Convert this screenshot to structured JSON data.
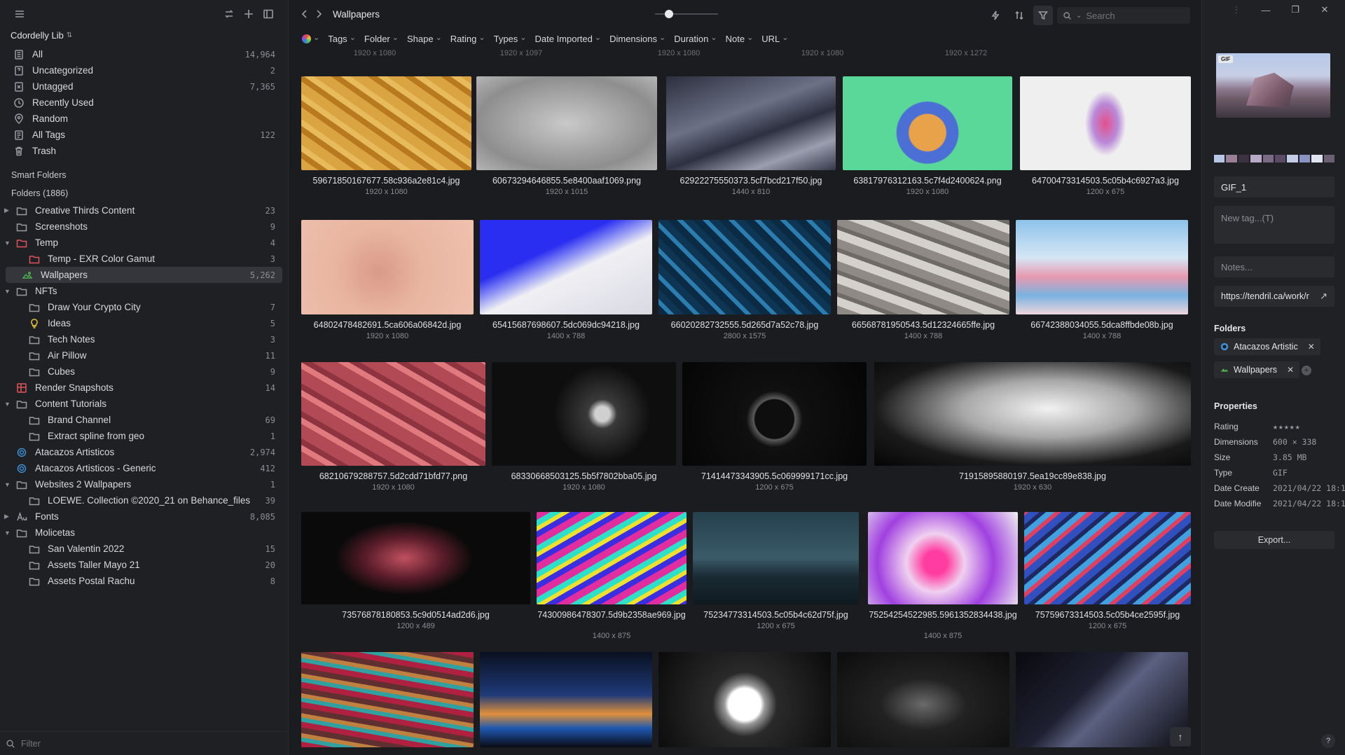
{
  "sidebar": {
    "library": "Cdordelly Lib",
    "items": [
      {
        "label": "All",
        "count": "14,964",
        "icon": "all-icon"
      },
      {
        "label": "Uncategorized",
        "count": "2",
        "icon": "uncategorized-icon"
      },
      {
        "label": "Untagged",
        "count": "7,365",
        "icon": "untagged-icon"
      },
      {
        "label": "Recently Used",
        "count": "",
        "icon": "clock-icon"
      },
      {
        "label": "Random",
        "count": "",
        "icon": "random-icon"
      },
      {
        "label": "All Tags",
        "count": "122",
        "icon": "tags-icon"
      },
      {
        "label": "Trash",
        "count": "",
        "icon": "trash-icon"
      }
    ],
    "smart_folders": "Smart Folders",
    "folders_header": "Folders (1886)",
    "folders": [
      {
        "label": "Creative Thirds Content",
        "count": "23",
        "level": 1,
        "caret": "right",
        "icon": "folder-icon"
      },
      {
        "label": "Screenshots",
        "count": "9",
        "level": 1,
        "caret": "",
        "icon": "folder-icon"
      },
      {
        "label": "Temp",
        "count": "4",
        "level": 1,
        "caret": "down",
        "icon": "folder-red-icon"
      },
      {
        "label": "Temp - EXR Color Gamut",
        "count": "3",
        "level": 2,
        "caret": "",
        "icon": "folder-red-icon"
      },
      {
        "label": "Wallpapers",
        "count": "5,262",
        "level": 1,
        "caret": "",
        "icon": "smart-folder-green-icon",
        "active": true
      },
      {
        "label": "NFTs",
        "count": "",
        "level": 1,
        "caret": "down",
        "icon": "folder-icon"
      },
      {
        "label": "Draw Your Crypto City",
        "count": "7",
        "level": 2,
        "caret": "",
        "icon": "folder-icon"
      },
      {
        "label": "Ideas",
        "count": "5",
        "level": 2,
        "caret": "",
        "icon": "lightbulb-icon"
      },
      {
        "label": "Tech Notes",
        "count": "3",
        "level": 2,
        "caret": "",
        "icon": "folder-icon"
      },
      {
        "label": "Air Pillow",
        "count": "11",
        "level": 2,
        "caret": "",
        "icon": "folder-icon"
      },
      {
        "label": "Cubes",
        "count": "9",
        "level": 2,
        "caret": "",
        "icon": "folder-icon"
      },
      {
        "label": "Render Snapshots",
        "count": "14",
        "level": 1,
        "caret": "",
        "icon": "render-icon"
      },
      {
        "label": "Content Tutorials",
        "count": "",
        "level": 1,
        "caret": "down",
        "icon": "folder-icon"
      },
      {
        "label": "Brand Channel",
        "count": "69",
        "level": 2,
        "caret": "",
        "icon": "folder-icon"
      },
      {
        "label": "Extract spline from geo",
        "count": "1",
        "level": 2,
        "caret": "",
        "icon": "folder-icon"
      },
      {
        "label": "Atacazos Artisticos",
        "count": "2,974",
        "level": 1,
        "caret": "",
        "icon": "smart-folder-blue-icon"
      },
      {
        "label": "Atacazos Artisticos - Generic",
        "count": "412",
        "level": 1,
        "caret": "",
        "icon": "smart-folder-blue-icon"
      },
      {
        "label": "Websites 2 Wallpapers",
        "count": "1",
        "level": 1,
        "caret": "down",
        "icon": "folder-icon"
      },
      {
        "label": "LOEWE. Collection ©2020_21 on Behance_files",
        "count": "39",
        "level": 2,
        "caret": "",
        "icon": "folder-icon"
      },
      {
        "label": "Fonts",
        "count": "8,085",
        "level": 1,
        "caret": "right",
        "icon": "font-icon"
      },
      {
        "label": "Molicetas",
        "count": "",
        "level": 1,
        "caret": "down",
        "icon": "folder-icon"
      },
      {
        "label": "San Valentin 2022",
        "count": "15",
        "level": 2,
        "caret": "",
        "icon": "folder-icon"
      },
      {
        "label": "Assets Taller Mayo 21",
        "count": "20",
        "level": 2,
        "caret": "",
        "icon": "folder-icon"
      },
      {
        "label": "Assets Postal Rachu",
        "count": "8",
        "level": 2,
        "caret": "",
        "icon": "folder-icon"
      }
    ],
    "filter_placeholder": "Filter"
  },
  "toolbar": {
    "breadcrumb": "Wallpapers",
    "search_placeholder": "Search",
    "filters": [
      "Tags",
      "Folder",
      "Shape",
      "Rating",
      "Types",
      "Date Imported",
      "Dimensions",
      "Duration",
      "Note",
      "URL"
    ]
  },
  "grid": {
    "top_dims": [
      "1920 x 1080",
      "1920 x 1097",
      "1920 x 1080",
      "1920 x 1080",
      "1920 x 1272"
    ],
    "items": [
      {
        "name": "59671850167677.58c936a2e81c4.jpg",
        "dims": "1920 x 1080",
        "bg": "repeating-linear-gradient(35deg,#d9a441 0 14px,#b8791f 14px 22px,#e7bb5c 22px 30px)"
      },
      {
        "name": "60673294646855.5e8400aaf1069.png",
        "dims": "1920 x 1015",
        "bg": "radial-gradient(ellipse at 50% 50%,#c9c9c9,#8e8e8e 70%,#b5b5b5)"
      },
      {
        "name": "62922275550373.5cf7bcd217f50.jpg",
        "dims": "1440 x 810",
        "bg": "linear-gradient(160deg,#2b2f3e,#6c7186 40%,#2c3040 60%,#9a9fb0 80%,#333748)"
      },
      {
        "name": "63817976312163.5c7f4d2400624.png",
        "dims": "1920 x 1080",
        "bg": "radial-gradient(circle at 50% 60%,#e8a24a 0 18%,#4b6fd4 19% 30%,#5ad89a 31%)"
      },
      {
        "name": "64700473314503.5c05b4c6927a3.jpg",
        "dims": "1200 x 675",
        "bg": "radial-gradient(ellipse 12% 35% at 50% 50%,#e4508c,#b989d8 60%,#efefef 100%)"
      },
      {
        "name": "64802478482691.5ca606a06842d.jpg",
        "dims": "1920 x 1080",
        "bg": "radial-gradient(circle at 45% 55%,#d99a88,#e8b5a0 40%,#f0c1ae)"
      },
      {
        "name": "65415687698607.5dc069dc94218.jpg",
        "dims": "1400 x 788",
        "bg": "linear-gradient(155deg,#2a2ef0 0 35%,#8a8ff5 45%,#f0f0f4 55%,#d8d9e2)"
      },
      {
        "name": "66020282732555.5d265d7a52c78.jpg",
        "dims": "2800 x 1575",
        "bg": "repeating-linear-gradient(45deg,#0b2a44 0 10px,#2b7db0 10px 16px,#0e3554 16px 26px)"
      },
      {
        "name": "66568781950543.5d12324665ffe.jpg",
        "dims": "1400 x 788",
        "bg": "repeating-linear-gradient(20deg,#8f8a85 0 12px,#d4d0cb 12px 24px,#6e6a66 24px 30px)"
      },
      {
        "name": "66742388034055.5dca8ffbde08b.jpg",
        "dims": "1400 x 788",
        "bg": "linear-gradient(180deg,#8ec3ea 0%,#d5e6f5 40%,#e89ab0 60%,#7ab2e0 80%,#f0d6de)"
      },
      {
        "name": "68210679288757.5d2cdd71bfd77.png",
        "dims": "1920 x 1080",
        "bg": "repeating-linear-gradient(30deg,#b14a55 0 18px,#e07a7e 18px 26px,#8e3440 26px 34px)"
      },
      {
        "name": "68330668503125.5b5f7802bba05.jpg",
        "dims": "1920 x 1080",
        "bg": "radial-gradient(circle at 60% 50%,#d0d0d0 0 6%,#3a3a3a 12%,#0e0e0e 40%)"
      },
      {
        "name": "71414473343905.5c069999171cc.jpg",
        "dims": "1200 x 675",
        "bg": "radial-gradient(circle at 50% 55%,#0e0e0e 0 18%,#5a5a5a 19%,#101010 26%,#050505)"
      },
      {
        "name": "71915895880197.5ea19cc89e838.jpg",
        "dims": "1920 x 630",
        "bg": "radial-gradient(ellipse at 55% 45%,#f2f2f2,#a8a8a8 35%,#1a1a1a 70%,#050505)"
      },
      {
        "name": "73576878180853.5c9d0514ad2d6.jpg",
        "dims": "1200 x 489",
        "bg": "radial-gradient(ellipse 30% 40% at 45% 50%,#c05060,#5c1d2a 55%,#0a0a0a)"
      },
      {
        "name": "74300986478307.5d9b2358ae969.jpg",
        "dims": "1400 x 875",
        "bg": "repeating-linear-gradient(150deg,#e02ea0 0 10px,#2ee0c8 10px 18px,#f0e02e 18px 24px,#3a2ee0 24px 32px)"
      },
      {
        "name": "75234773314503.5c05b4c62d75f.jpg",
        "dims": "1200 x 675",
        "bg": "linear-gradient(180deg,#26404e,#3a5a68 50%,#1a2a33 70%,#0f1a20)"
      },
      {
        "name": "75254254522985.5961352834438.jpg",
        "dims": "1400 x 875",
        "bg": "radial-gradient(circle at 45% 55%,#ff3da0 0 12%,#f0d0f0 30%,#a040e0 60%,#f0f0f0)"
      },
      {
        "name": "75759673314503.5c05b4ce2595f.jpg",
        "dims": "1200 x 675",
        "bg": "repeating-linear-gradient(-40deg,#3050c0 0 10px,#e04060 10px 16px,#40a0e0 16px 24px,#202860 24px 30px)"
      },
      {
        "name": "",
        "dims": "",
        "bg": "repeating-linear-gradient(10deg,#b02040 0 8px,#30a0a0 8px 14px,#c08040 14px 20px,#603030 20px 28px)"
      },
      {
        "name": "",
        "dims": "",
        "bg": "linear-gradient(180deg,#0a1020 0%,#1e3a78 45%,#e0903a 65%,#1e58b0 80%,#0a0a14)"
      },
      {
        "name": "",
        "dims": "",
        "bg": "radial-gradient(circle at 50% 55%,#ffffff 0 16%,#9a9a9a 20%,#2a2a2a 32%,#0a0a0a)"
      },
      {
        "name": "",
        "dims": "",
        "bg": "radial-gradient(ellipse at 50% 55%,#6a6a6a,#222 35%,#0c0c0c)"
      },
      {
        "name": "",
        "dims": "",
        "bg": "linear-gradient(135deg,#0a0a10,#1e2030 40%,#5a6080 55%,#0c0c12)"
      }
    ]
  },
  "inspector": {
    "badge": "GIF",
    "palette": [
      "#b8c6e6",
      "#9b7f98",
      "#3b3242",
      "#b9a8c6",
      "#7a6a86",
      "#5a4a66",
      "#c4cde8",
      "#8a94c2",
      "#e0e4f0",
      "#6b5f74"
    ],
    "name": "GIF_1",
    "tags_placeholder": "New tag...(T)",
    "notes_placeholder": "Notes...",
    "url": "https://tendril.ca/work/r",
    "folders_title": "Folders",
    "folders": [
      "Atacazos Artistic",
      "Wallpapers"
    ],
    "properties_title": "Properties",
    "props": [
      {
        "k": "Rating",
        "v": "★★★★★"
      },
      {
        "k": "Dimensions",
        "v": "600 × 338"
      },
      {
        "k": "Size",
        "v": "3.85 MB"
      },
      {
        "k": "Type",
        "v": "GIF"
      },
      {
        "k": "Date Create",
        "v": "2021/04/22 18:1"
      },
      {
        "k": "Date Modifie",
        "v": "2021/04/22 18:1"
      }
    ],
    "export": "Export..."
  },
  "colors": {
    "accent": "#4a9fe0",
    "sidebar_bg": "#1f2023",
    "main_bg": "#1b1c1f"
  }
}
